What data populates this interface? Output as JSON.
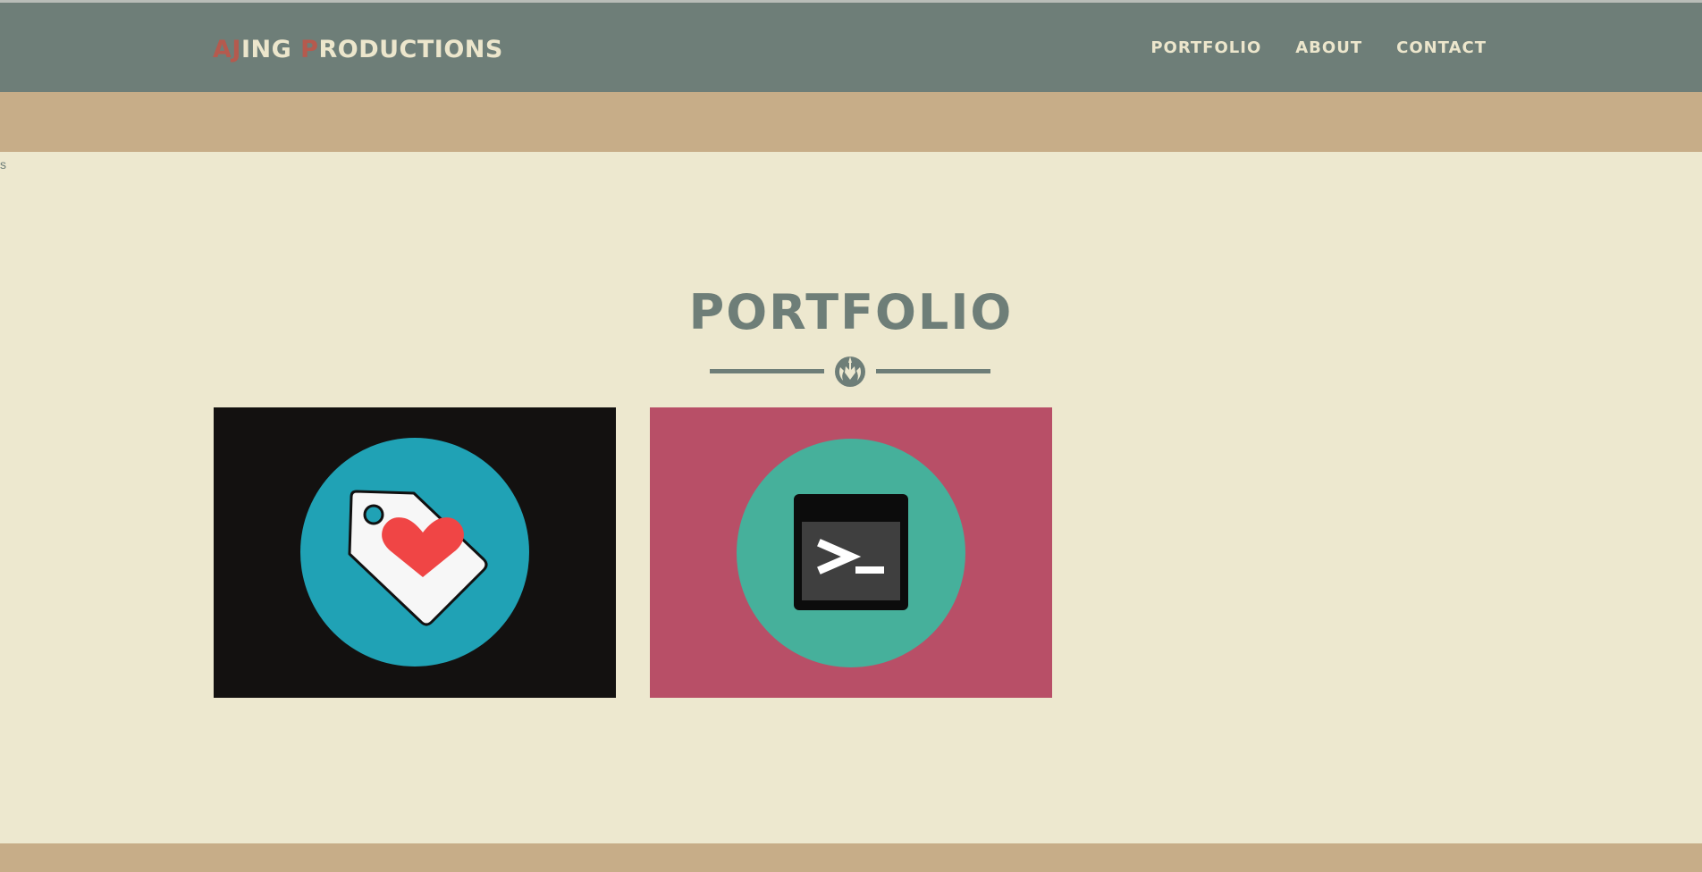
{
  "brand": {
    "part1_accent": "AJ",
    "part1_rest": "ING ",
    "part2_accent": "P",
    "part2_rest": "RODUCTIONS"
  },
  "nav": {
    "items": [
      "PORTFOLIO",
      "ABOUT",
      "CONTACT"
    ]
  },
  "stray_text": "s",
  "portfolio": {
    "title": "PORTFOLIO",
    "divider_icon": "rebel-alliance-icon",
    "items": [
      {
        "icon": "price-tag-heart-icon",
        "background": "#131110",
        "circle": "#20a2b5"
      },
      {
        "icon": "terminal-icon",
        "background": "#b84f67",
        "circle": "#46b09b",
        "glyph": ">_"
      }
    ]
  },
  "colors": {
    "navbar": "#6e7e78",
    "band": "#c7ad88",
    "page": "#ede8cf",
    "nav_text": "#ece6cc",
    "brand_accent": "#b55a4e",
    "heading": "#6e7e78"
  }
}
